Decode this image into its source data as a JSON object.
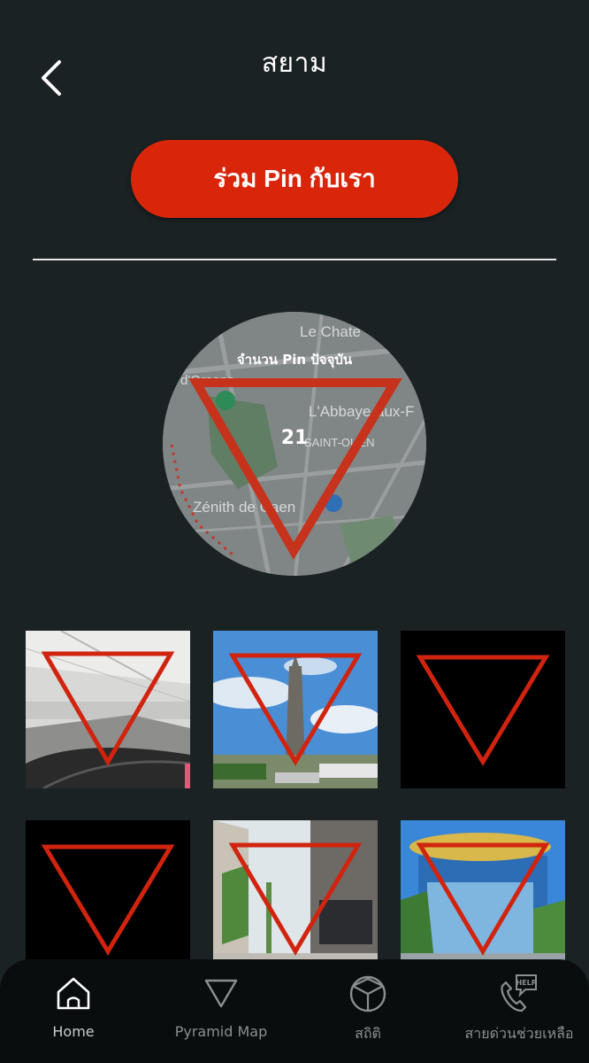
{
  "header": {
    "title": "สยาม",
    "back_icon": "chevron-left-icon"
  },
  "join_button": {
    "label": "ร่วม Pin กับเรา",
    "color": "#d9260b"
  },
  "pin_summary": {
    "label": "จำนวน Pin ปัจจุบัน",
    "count": "21",
    "map_labels": [
      "Le Chate",
      "d'Ornano",
      "L'Abbaye-aux-F",
      "SAINT-OUEN",
      "Zénith de Caen"
    ]
  },
  "photos": [
    {
      "subject": "office-interior"
    },
    {
      "subject": "victory-monument"
    },
    {
      "subject": "black-placeholder"
    },
    {
      "subject": "black-placeholder"
    },
    {
      "subject": "street-shops"
    },
    {
      "subject": "mall-facade"
    }
  ],
  "bottom_nav": {
    "items": [
      {
        "label": "Home",
        "icon": "home-icon",
        "active": true
      },
      {
        "label": "Pyramid Map",
        "icon": "triangle-icon",
        "active": false
      },
      {
        "label": "สถิติ",
        "icon": "cube-icon",
        "active": false
      },
      {
        "label": "สายด่วนช่วยเหลือ",
        "icon": "help-phone-icon",
        "active": false
      }
    ],
    "help_badge": "HELP"
  },
  "colors": {
    "background": "#1b2224",
    "accent": "#d9260b",
    "nav_background": "#0a0d0e"
  }
}
